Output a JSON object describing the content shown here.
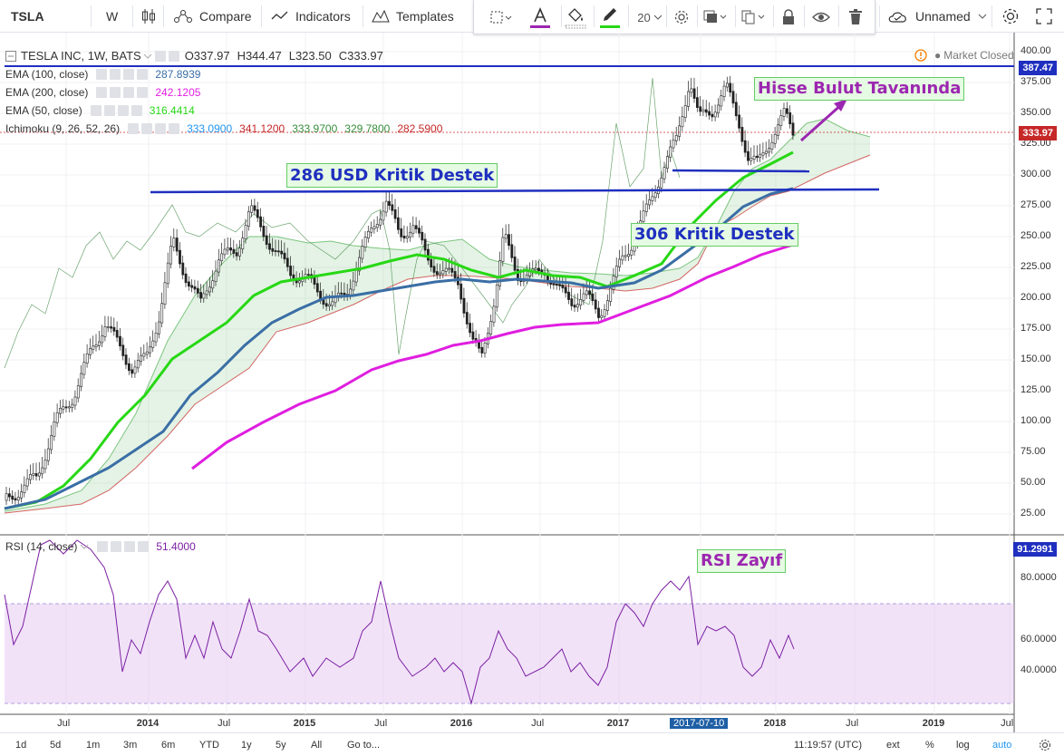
{
  "toolbar": {
    "symbol": "TSLA",
    "interval": "W",
    "compare": "Compare",
    "indicators": "Indicators",
    "templates": "Templates",
    "layout": "Unnamed"
  },
  "drawing": {
    "font_size": "20"
  },
  "legend": {
    "title": "TESLA INC, 1W, BATS",
    "ohlc": [
      "O337.97",
      "H344.47",
      "L323.50",
      "C333.97"
    ],
    "market": "Market Closed",
    "ema100": {
      "label": "EMA (100, close)",
      "value": "287.8939",
      "color": "#3a6ea5"
    },
    "ema200": {
      "label": "EMA (200, close)",
      "value": "242.1205",
      "color": "#e01ee0"
    },
    "ema50": {
      "label": "EMA (50, close)",
      "value": "316.4414",
      "color": "#27d815"
    },
    "ichimoku": {
      "label": "Ichimoku (9, 26, 52, 26)",
      "values": [
        "333.0900",
        "341.1200",
        "333.9700",
        "329.7800",
        "282.5900"
      ],
      "colors": [
        "#2196f3",
        "#c62828",
        "#388e3c",
        "#388e3c",
        "#c62828"
      ]
    }
  },
  "price_axis": [
    "400.00",
    "375.00",
    "350.00",
    "325.00",
    "300.00",
    "275.00",
    "250.00",
    "225.00",
    "200.00",
    "175.00",
    "150.00",
    "125.00",
    "100.00",
    "75.00",
    "50.00",
    "25.00"
  ],
  "price_tags": {
    "top": "387.47",
    "last": "333.97"
  },
  "rsi": {
    "label": "RSI (14, close)",
    "value": "51.4000",
    "tag": "91.2991",
    "axis": [
      "80.0000",
      "60.0000",
      "40.0000"
    ]
  },
  "time_axis": [
    "Jul",
    "2014",
    "Jul",
    "2015",
    "Jul",
    "2016",
    "Jul",
    "2017",
    "2017-07-10",
    "2018",
    "Jul",
    "2019",
    "Jul"
  ],
  "annotations": {
    "ceiling": "Hisse Bulut Tavanında",
    "support286": "286 USD Kritik Destek",
    "support306": "306 Kritik Destek",
    "rsi": "RSI Zayıf"
  },
  "bottom": {
    "ranges": [
      "1d",
      "5d",
      "1m",
      "3m",
      "6m",
      "YTD",
      "1y",
      "5y",
      "All"
    ],
    "goto": "Go to...",
    "time": "11:19:57 (UTC)",
    "opts": [
      "ext",
      "%",
      "log",
      "auto"
    ]
  }
}
